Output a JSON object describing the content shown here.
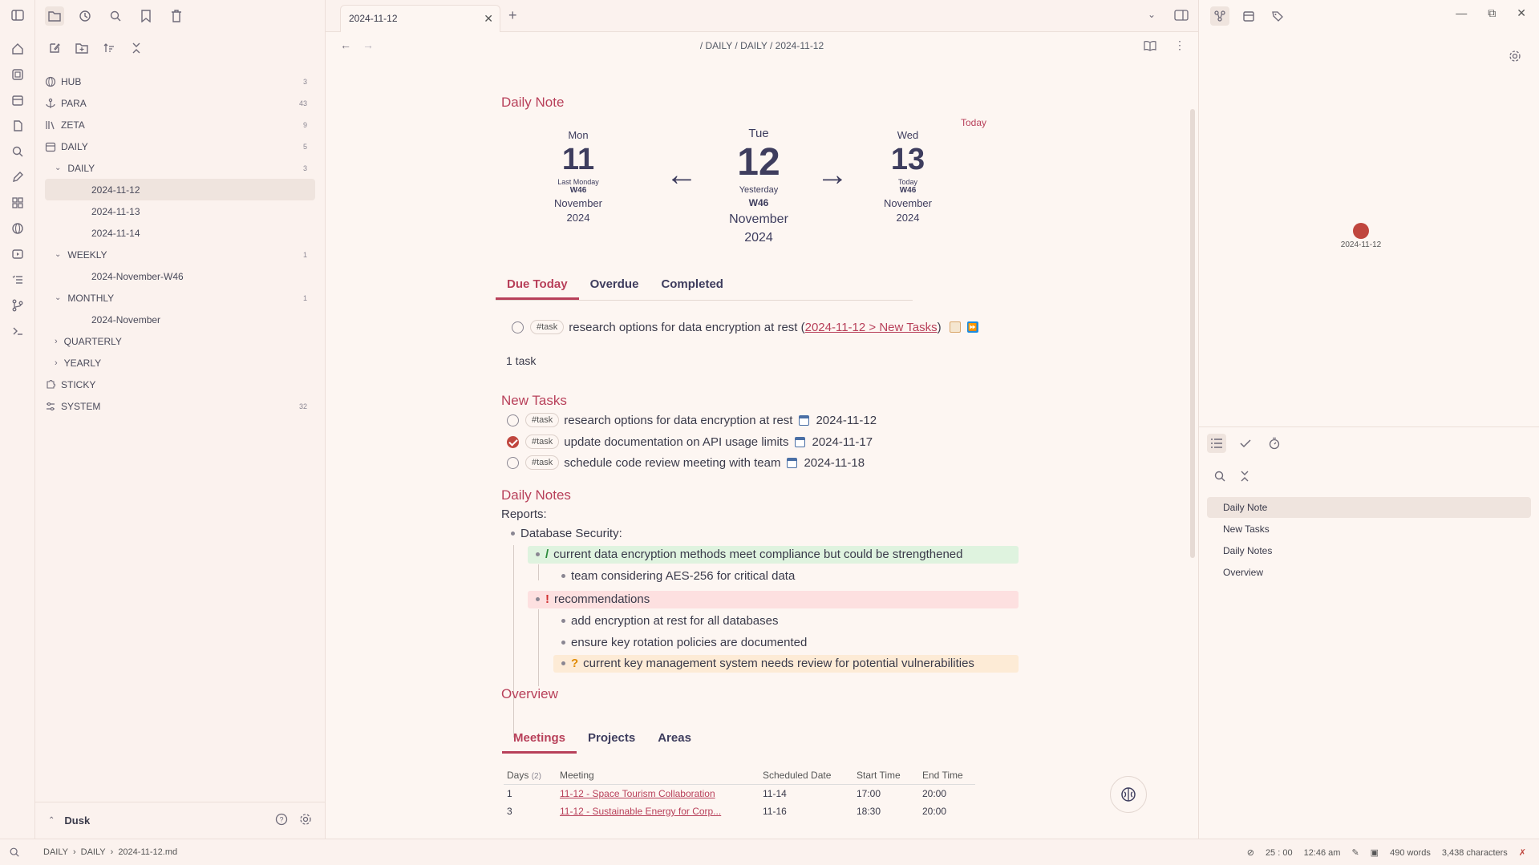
{
  "sidebar": {
    "vault_name": "Dusk",
    "tree": [
      {
        "label": "HUB",
        "count": "3"
      },
      {
        "label": "PARA",
        "count": "43"
      },
      {
        "label": "ZETA",
        "count": "9"
      },
      {
        "label": "DAILY",
        "count": "5"
      },
      {
        "label": "DAILY",
        "count": "3"
      },
      {
        "label": "2024-11-12",
        "count": ""
      },
      {
        "label": "2024-11-13",
        "count": ""
      },
      {
        "label": "2024-11-14",
        "count": ""
      },
      {
        "label": "WEEKLY",
        "count": "1"
      },
      {
        "label": "2024-November-W46",
        "count": ""
      },
      {
        "label": "MONTHLY",
        "count": "1"
      },
      {
        "label": "2024-November",
        "count": ""
      },
      {
        "label": "QUARTERLY",
        "count": ""
      },
      {
        "label": "YEARLY",
        "count": ""
      },
      {
        "label": "STICKY",
        "count": ""
      },
      {
        "label": "SYSTEM",
        "count": "32"
      }
    ]
  },
  "tab": {
    "title": "2024-11-12"
  },
  "breadcrumb": "/ DAILY / DAILY / 2024-11-12",
  "note": {
    "h_daily_note": "Daily Note",
    "today_label": "Today",
    "prev": {
      "dow": "Mon",
      "num": "11",
      "rel": "Last Monday",
      "week": "W46",
      "month": "November",
      "year": "2024"
    },
    "cur": {
      "dow": "Tue",
      "num": "12",
      "rel": "Yesterday",
      "week": "W46",
      "month": "November",
      "year": "2024"
    },
    "next": {
      "dow": "Wed",
      "num": "13",
      "rel": "Today",
      "week": "W46",
      "month": "November",
      "year": "2024"
    },
    "task_tabs": [
      "Due Today",
      "Overdue",
      "Completed"
    ],
    "due_task": {
      "tag": "#task",
      "text": "research options for data encryption at rest (",
      "link": "2024-11-12 > New Tasks",
      "close": ")"
    },
    "task_count": "1 task",
    "h_new_tasks": "New Tasks",
    "new_tasks": [
      {
        "tag": "#task",
        "text": "research options for data encryption at rest",
        "date": "2024-11-12",
        "done": false
      },
      {
        "tag": "#task",
        "text": "update documentation on API usage limits",
        "date": "2024-11-17",
        "done": true
      },
      {
        "tag": "#task",
        "text": "schedule code review meeting with team",
        "date": "2024-11-18",
        "done": false
      }
    ],
    "h_daily_notes": "Daily Notes",
    "reports": "Reports:",
    "db_security": "Database Security:",
    "b1_mark": "/",
    "b1": "current data encryption methods meet compliance but could be strengthened",
    "b1a": "team considering AES-256 for critical data",
    "b2_mark": "!",
    "b2": "recommendations",
    "b2a": "add encryption at rest for all databases",
    "b2b": "ensure key rotation policies are documented",
    "b3_mark": "?",
    "b3": "current key management system needs review for potential vulnerabilities",
    "h_overview": "Overview",
    "overview_tabs": [
      "Meetings",
      "Projects",
      "Areas"
    ],
    "table": {
      "headers": [
        "Days",
        "(2)",
        "Meeting",
        "Scheduled Date",
        "Start Time",
        "End Time"
      ],
      "rows": [
        {
          "days": "1",
          "meeting": "11-12 - Space Tourism Collaboration",
          "date": "11-14",
          "start": "17:00",
          "end": "20:00"
        },
        {
          "days": "3",
          "meeting": "11-12 - Sustainable Energy for Corp...",
          "date": "11-16",
          "start": "18:30",
          "end": "20:00"
        }
      ]
    }
  },
  "right": {
    "graph_node_label": "2024-11-12",
    "outline": [
      "Daily Note",
      "New Tasks",
      "Daily Notes",
      "Overview"
    ]
  },
  "status": {
    "path": [
      "DAILY",
      "DAILY",
      "2024-11-12.md"
    ],
    "timer": "25 : 00",
    "time": "12:46 am",
    "words": "490 words",
    "chars": "3,438 characters"
  },
  "colors": {
    "accent": "#b8405a",
    "background": "#fdf6f2",
    "green_highlight": "#dff3df",
    "red_highlight": "#fde0e0",
    "orange_highlight": "#fdebd6"
  }
}
